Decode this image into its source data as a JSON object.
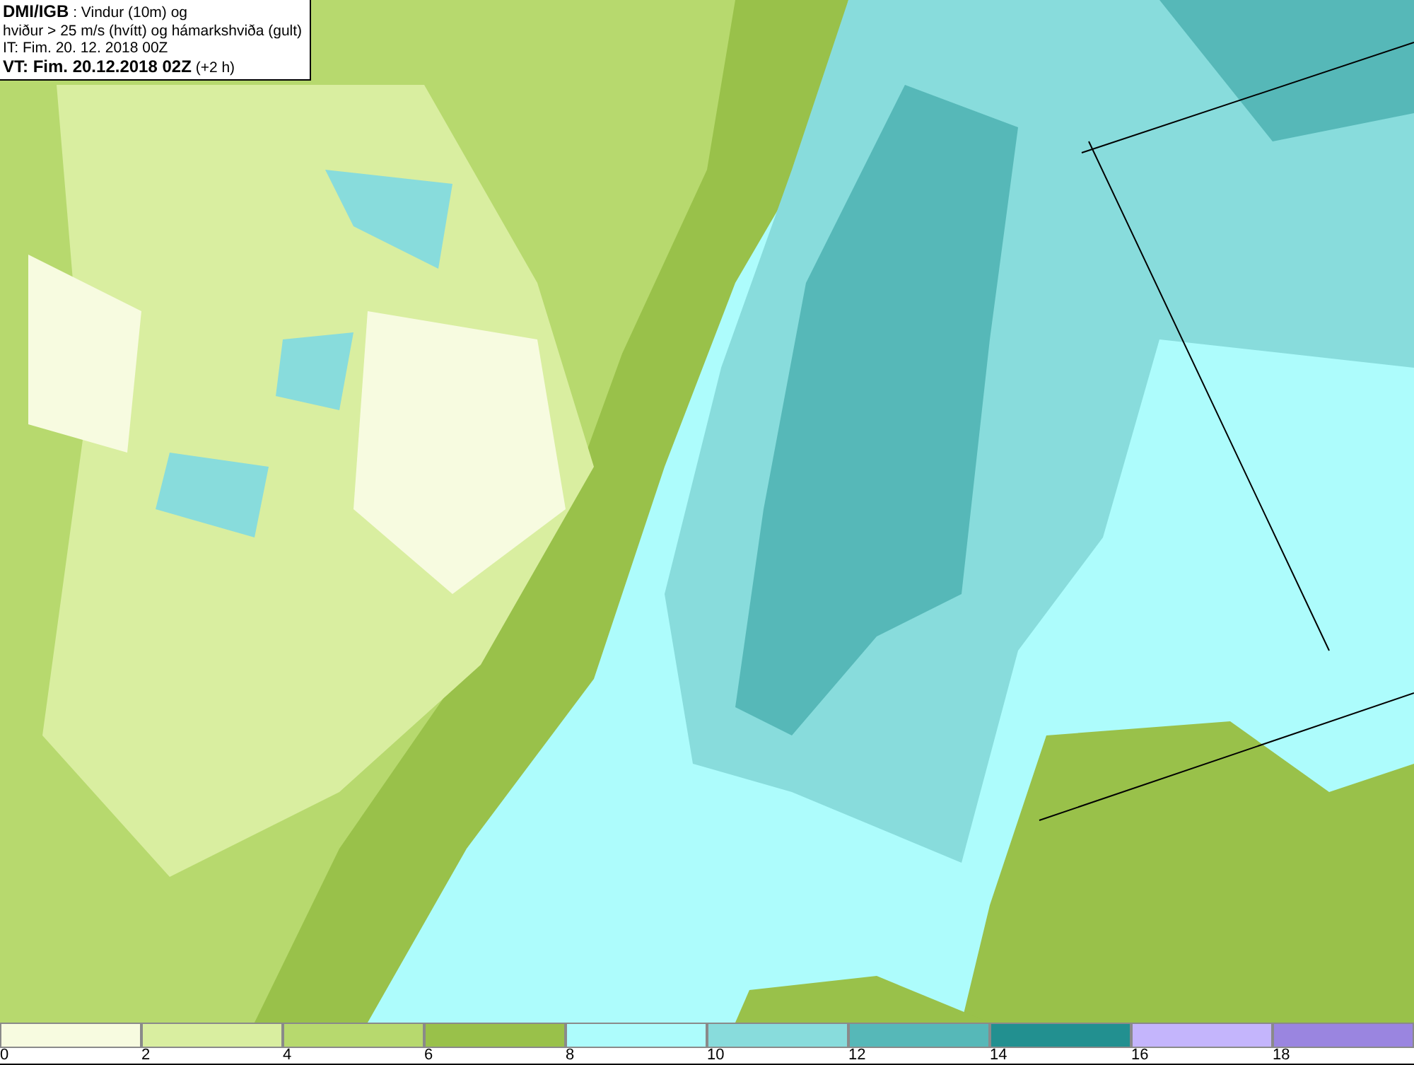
{
  "title_box": {
    "lines": [
      "**DMI/IGB** : Vindur (10m) og",
      "hviður > 25 m/s (hvítt) og hámarkshviða (gult)",
      "IT: Fim. 20. 12. 2018 00Z",
      "**VT: Fim. 20.12.2018 02Z** (+2 h)"
    ]
  },
  "legend": [
    {
      "label": "0",
      "color": "#f7fbe0"
    },
    {
      "label": "2",
      "color": "#d9eea0"
    },
    {
      "label": "4",
      "color": "#b7d96e"
    },
    {
      "label": "6",
      "color": "#99c14a"
    },
    {
      "label": "8",
      "color": "#adfcfc"
    },
    {
      "label": "10",
      "color": "#88dcdc"
    },
    {
      "label": "12",
      "color": "#56b8b8"
    },
    {
      "label": "14",
      "color": "#229090"
    },
    {
      "label": "16",
      "color": "#c4b5fc"
    },
    {
      "label": "18",
      "color": "#9a85e0"
    }
  ]
}
